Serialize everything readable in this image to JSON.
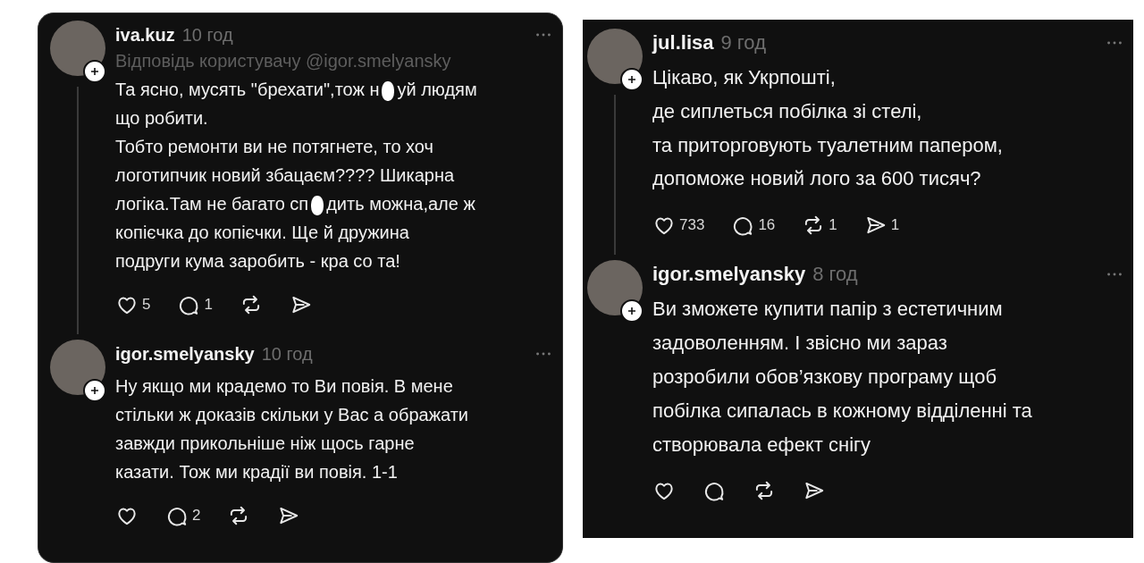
{
  "panels": [
    {
      "posts": [
        {
          "username": "iva.kuz",
          "time": "10 год",
          "reply_to": "Відповідь користувачу @igor.smelyansky",
          "thread_line": true,
          "text_parts": [
            "Та ясно, мусять \"брехати\",тож н",
            "уй людям\nщо робити.\nТобто ремонти ви не потягнете, то хоч\nлоготипчик новий збацаєм???? Шикарна\nлогіка.Там не багато сп",
            "дить можна,але ж\nкопієчка до копієчки. Ще й дружина\nподруги кума заробить - кра со та!"
          ],
          "actions": [
            {
              "kind": "like",
              "count": "5"
            },
            {
              "kind": "comment",
              "count": "1"
            },
            {
              "kind": "repost"
            },
            {
              "kind": "share"
            }
          ]
        },
        {
          "username": "igor.smelyansky",
          "time": "10 год",
          "thread_line": false,
          "text_parts": [
            "Ну якщо ми крадемо то Ви повія. В мене\nстільки ж доказів скільки у Вас а ображати\nзавжди прикольніше ніж щось гарне\nказати. Тож ми крадії ви повія. 1-1"
          ],
          "actions": [
            {
              "kind": "like"
            },
            {
              "kind": "comment",
              "count": "2"
            },
            {
              "kind": "repost"
            },
            {
              "kind": "share"
            }
          ]
        }
      ]
    },
    {
      "posts": [
        {
          "username": "jul.lisa",
          "time": "9 год",
          "thread_line": true,
          "text_parts": [
            "Цікаво, як Укрпошті,\nде сиплеться побілка зі стелі,\nта приторговують туалетним папером,\nдопоможе новий лого за 600 тисяч?"
          ],
          "actions": [
            {
              "kind": "like",
              "count": "733"
            },
            {
              "kind": "comment",
              "count": "16"
            },
            {
              "kind": "repost",
              "count": "1"
            },
            {
              "kind": "share",
              "count": "1"
            }
          ]
        },
        {
          "username": "igor.smelyansky",
          "time": "8 год",
          "thread_line": false,
          "text_parts": [
            "Ви зможете купити папір з естетичним\nзадоволенням. І звісно ми зараз\nрозробили обов’язкову програму щоб\nпобілка сипалась в кожному відділенні та\nстворювала ефект снігу"
          ],
          "actions": [
            {
              "kind": "like"
            },
            {
              "kind": "comment"
            },
            {
              "kind": "repost"
            },
            {
              "kind": "share"
            }
          ]
        }
      ]
    }
  ]
}
